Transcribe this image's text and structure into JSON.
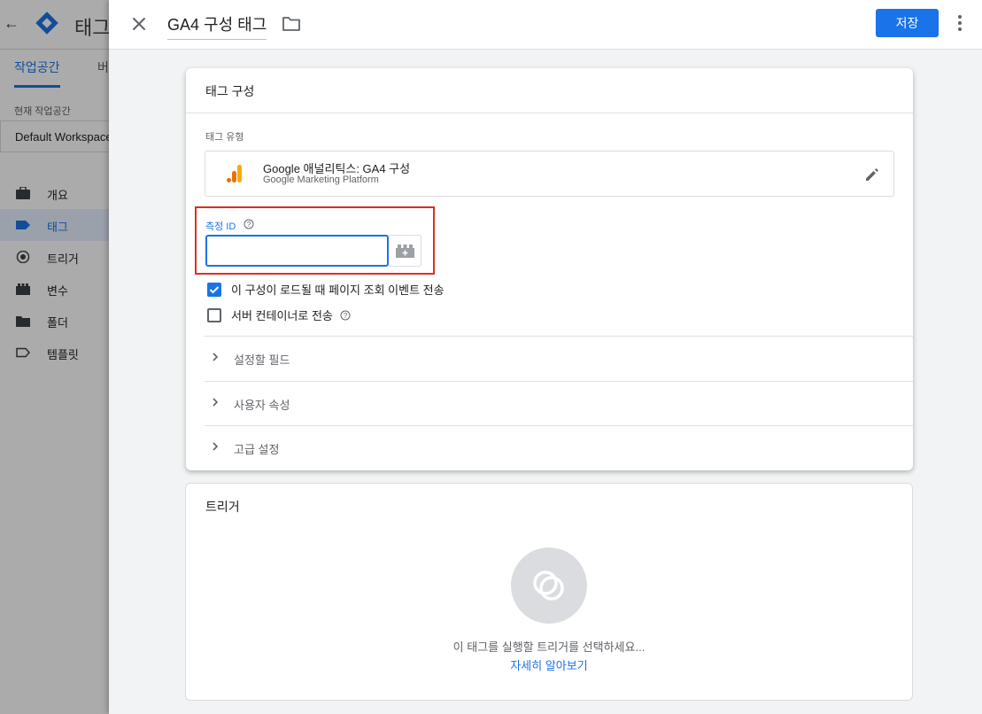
{
  "background": {
    "app_title": "태그",
    "tabs": {
      "active": "작업공간",
      "second": "버"
    },
    "workspace": {
      "label": "현재 작업공간",
      "name": "Default Workspace"
    },
    "nav": [
      {
        "label": "개요",
        "icon": "briefcase-icon"
      },
      {
        "label": "태그",
        "icon": "tag-icon",
        "active": true
      },
      {
        "label": "트리거",
        "icon": "trigger-icon"
      },
      {
        "label": "변수",
        "icon": "variable-icon"
      },
      {
        "label": "폴더",
        "icon": "folder-icon"
      },
      {
        "label": "템플릿",
        "icon": "template-icon"
      }
    ]
  },
  "header": {
    "title": "GA4 구성 태그",
    "save_label": "저장"
  },
  "config": {
    "section_title": "태그 구성",
    "tag_type_label": "태그 유형",
    "tag_type_name": "Google 애널리틱스: GA4 구성",
    "tag_type_sub": "Google Marketing Platform",
    "measurement_id_label": "측정 ID",
    "measurement_id_value": "",
    "checkbox_pageview": {
      "label": "이 구성이 로드될 때 페이지 조회 이벤트 전송",
      "checked": true
    },
    "checkbox_server": {
      "label": "서버 컨테이너로 전송",
      "checked": false
    },
    "sections": [
      "설정할 필드",
      "사용자 속성",
      "고급 설정"
    ]
  },
  "trigger": {
    "title": "트리거",
    "hint": "이 태그를 실행할 트리거를 선택하세요...",
    "learn_more": "자세히 알아보기"
  },
  "colors": {
    "accent": "#1a73e8",
    "highlight": "#d93025",
    "ga_orange": "#f9ab00",
    "ga_dark": "#e37400"
  }
}
